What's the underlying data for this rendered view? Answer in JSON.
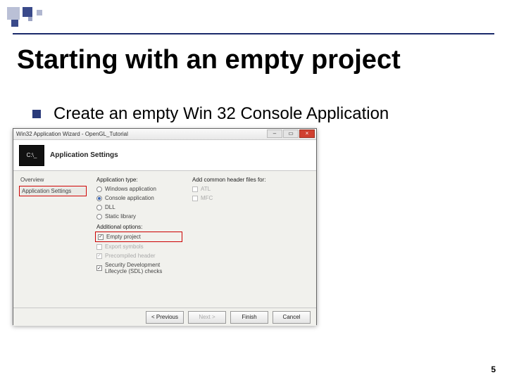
{
  "slide": {
    "title": "Starting with an empty project",
    "bullet": "Create an empty Win 32 Console Application",
    "page_number": "5"
  },
  "dialog": {
    "title": "Win32 Application Wizard - OpenGL_Tutorial",
    "close_glyph": "×",
    "banner_icon_text": "C:\\_",
    "banner_heading": "Application Settings",
    "sidebar": {
      "overview": "Overview",
      "app_settings": "Application Settings"
    },
    "app_type_heading": "Application type:",
    "app_types": {
      "windows": "Windows application",
      "console": "Console application",
      "dll": "DLL",
      "static": "Static library"
    },
    "additional_heading": "Additional options:",
    "additional": {
      "empty": "Empty project",
      "export": "Export symbols",
      "precompiled": "Precompiled header",
      "sdl": "Security Development Lifecycle (SDL) checks"
    },
    "header_files_heading": "Add common header files for:",
    "header_files": {
      "atl": "ATL",
      "mfc": "MFC"
    },
    "buttons": {
      "prev": "< Previous",
      "next": "Next >",
      "finish": "Finish",
      "cancel": "Cancel"
    }
  }
}
